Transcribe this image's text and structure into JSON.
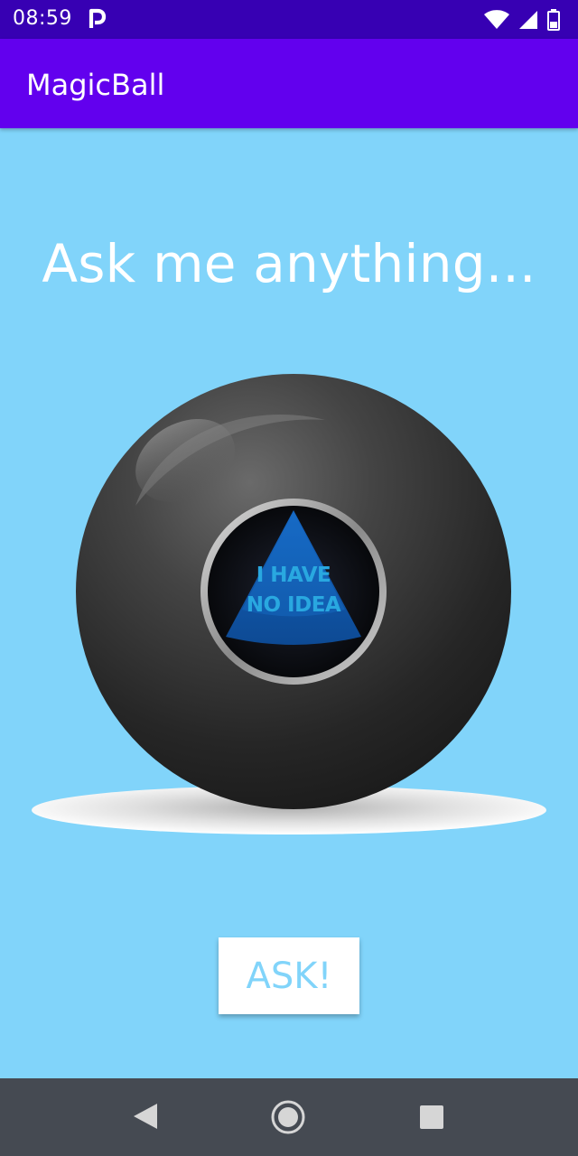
{
  "status_bar": {
    "time": "08:59",
    "icons": [
      "parking-icon",
      "wifi-icon",
      "signal-icon",
      "battery-icon"
    ]
  },
  "app_bar": {
    "title": "MagicBall"
  },
  "main": {
    "heading": "Ask me anything...",
    "answer_line_1": "I HAVE",
    "answer_line_2": "NO IDEA",
    "ask_button_label": "ASK!"
  },
  "nav_bar": {
    "icons": [
      "back-icon",
      "home-icon",
      "recents-icon"
    ]
  },
  "colors": {
    "background": "#81d4fa",
    "app_bar": "#6200ee",
    "status_bar": "#3700b3",
    "nav_bar": "#454a52",
    "answer_text": "#29a8e0"
  }
}
